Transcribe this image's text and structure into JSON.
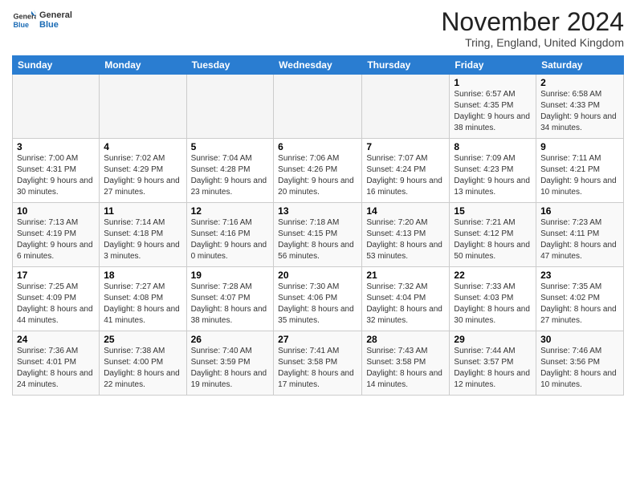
{
  "logo": {
    "general": "General",
    "blue": "Blue"
  },
  "header": {
    "title": "November 2024",
    "subtitle": "Tring, England, United Kingdom"
  },
  "columns": [
    "Sunday",
    "Monday",
    "Tuesday",
    "Wednesday",
    "Thursday",
    "Friday",
    "Saturday"
  ],
  "weeks": [
    [
      {
        "day": "",
        "info": ""
      },
      {
        "day": "",
        "info": ""
      },
      {
        "day": "",
        "info": ""
      },
      {
        "day": "",
        "info": ""
      },
      {
        "day": "",
        "info": ""
      },
      {
        "day": "1",
        "info": "Sunrise: 6:57 AM\nSunset: 4:35 PM\nDaylight: 9 hours and 38 minutes."
      },
      {
        "day": "2",
        "info": "Sunrise: 6:58 AM\nSunset: 4:33 PM\nDaylight: 9 hours and 34 minutes."
      }
    ],
    [
      {
        "day": "3",
        "info": "Sunrise: 7:00 AM\nSunset: 4:31 PM\nDaylight: 9 hours and 30 minutes."
      },
      {
        "day": "4",
        "info": "Sunrise: 7:02 AM\nSunset: 4:29 PM\nDaylight: 9 hours and 27 minutes."
      },
      {
        "day": "5",
        "info": "Sunrise: 7:04 AM\nSunset: 4:28 PM\nDaylight: 9 hours and 23 minutes."
      },
      {
        "day": "6",
        "info": "Sunrise: 7:06 AM\nSunset: 4:26 PM\nDaylight: 9 hours and 20 minutes."
      },
      {
        "day": "7",
        "info": "Sunrise: 7:07 AM\nSunset: 4:24 PM\nDaylight: 9 hours and 16 minutes."
      },
      {
        "day": "8",
        "info": "Sunrise: 7:09 AM\nSunset: 4:23 PM\nDaylight: 9 hours and 13 minutes."
      },
      {
        "day": "9",
        "info": "Sunrise: 7:11 AM\nSunset: 4:21 PM\nDaylight: 9 hours and 10 minutes."
      }
    ],
    [
      {
        "day": "10",
        "info": "Sunrise: 7:13 AM\nSunset: 4:19 PM\nDaylight: 9 hours and 6 minutes."
      },
      {
        "day": "11",
        "info": "Sunrise: 7:14 AM\nSunset: 4:18 PM\nDaylight: 9 hours and 3 minutes."
      },
      {
        "day": "12",
        "info": "Sunrise: 7:16 AM\nSunset: 4:16 PM\nDaylight: 9 hours and 0 minutes."
      },
      {
        "day": "13",
        "info": "Sunrise: 7:18 AM\nSunset: 4:15 PM\nDaylight: 8 hours and 56 minutes."
      },
      {
        "day": "14",
        "info": "Sunrise: 7:20 AM\nSunset: 4:13 PM\nDaylight: 8 hours and 53 minutes."
      },
      {
        "day": "15",
        "info": "Sunrise: 7:21 AM\nSunset: 4:12 PM\nDaylight: 8 hours and 50 minutes."
      },
      {
        "day": "16",
        "info": "Sunrise: 7:23 AM\nSunset: 4:11 PM\nDaylight: 8 hours and 47 minutes."
      }
    ],
    [
      {
        "day": "17",
        "info": "Sunrise: 7:25 AM\nSunset: 4:09 PM\nDaylight: 8 hours and 44 minutes."
      },
      {
        "day": "18",
        "info": "Sunrise: 7:27 AM\nSunset: 4:08 PM\nDaylight: 8 hours and 41 minutes."
      },
      {
        "day": "19",
        "info": "Sunrise: 7:28 AM\nSunset: 4:07 PM\nDaylight: 8 hours and 38 minutes."
      },
      {
        "day": "20",
        "info": "Sunrise: 7:30 AM\nSunset: 4:06 PM\nDaylight: 8 hours and 35 minutes."
      },
      {
        "day": "21",
        "info": "Sunrise: 7:32 AM\nSunset: 4:04 PM\nDaylight: 8 hours and 32 minutes."
      },
      {
        "day": "22",
        "info": "Sunrise: 7:33 AM\nSunset: 4:03 PM\nDaylight: 8 hours and 30 minutes."
      },
      {
        "day": "23",
        "info": "Sunrise: 7:35 AM\nSunset: 4:02 PM\nDaylight: 8 hours and 27 minutes."
      }
    ],
    [
      {
        "day": "24",
        "info": "Sunrise: 7:36 AM\nSunset: 4:01 PM\nDaylight: 8 hours and 24 minutes."
      },
      {
        "day": "25",
        "info": "Sunrise: 7:38 AM\nSunset: 4:00 PM\nDaylight: 8 hours and 22 minutes."
      },
      {
        "day": "26",
        "info": "Sunrise: 7:40 AM\nSunset: 3:59 PM\nDaylight: 8 hours and 19 minutes."
      },
      {
        "day": "27",
        "info": "Sunrise: 7:41 AM\nSunset: 3:58 PM\nDaylight: 8 hours and 17 minutes."
      },
      {
        "day": "28",
        "info": "Sunrise: 7:43 AM\nSunset: 3:58 PM\nDaylight: 8 hours and 14 minutes."
      },
      {
        "day": "29",
        "info": "Sunrise: 7:44 AM\nSunset: 3:57 PM\nDaylight: 8 hours and 12 minutes."
      },
      {
        "day": "30",
        "info": "Sunrise: 7:46 AM\nSunset: 3:56 PM\nDaylight: 8 hours and 10 minutes."
      }
    ]
  ]
}
